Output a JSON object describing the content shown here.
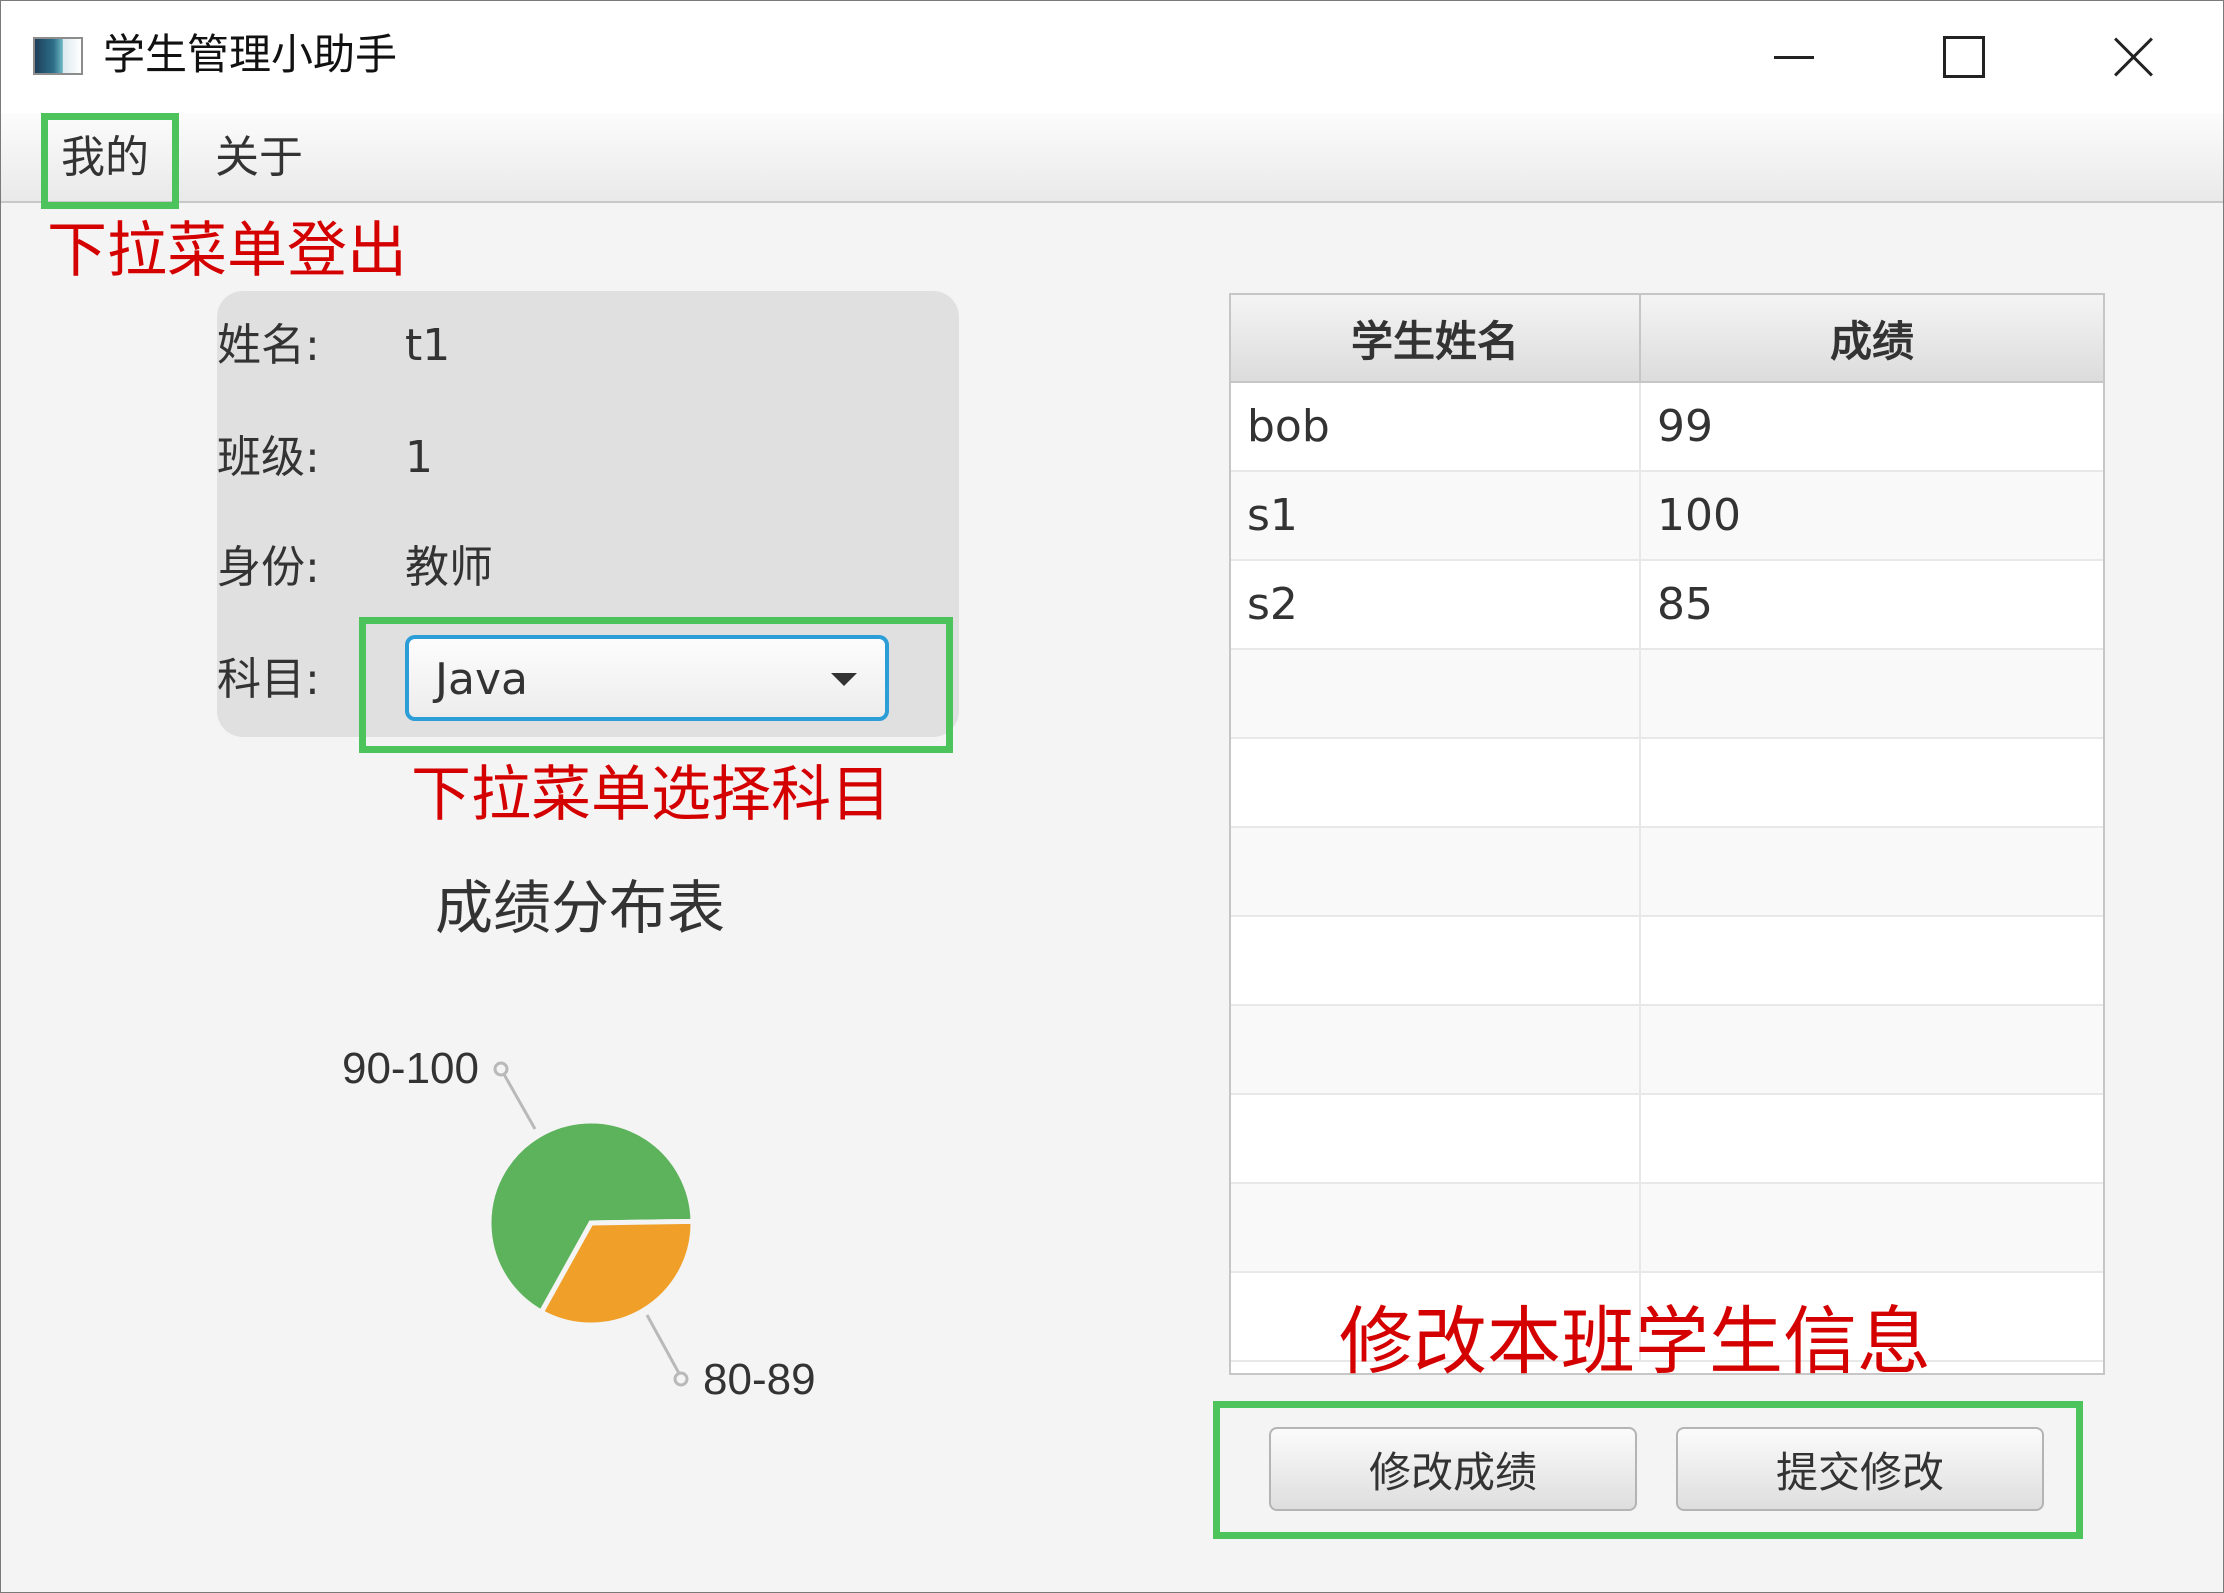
{
  "window": {
    "title": "学生管理小助手"
  },
  "menu": {
    "items": [
      "我的",
      "关于"
    ]
  },
  "annotations": {
    "logout": "下拉菜单登出",
    "select_subject": "下拉菜单选择科目",
    "edit_class": "修改本班学生信息"
  },
  "profile": {
    "name_label": "姓名:",
    "name_value": "t1",
    "class_label": "班级:",
    "class_value": "1",
    "role_label": "身份:",
    "role_value": "教师",
    "subject_label": "科目:",
    "subject_value": "Java"
  },
  "chart_data": {
    "type": "pie",
    "title": "成绩分布表",
    "labels": [
      "90-100",
      "80-89"
    ],
    "values": [
      2,
      1
    ],
    "colors": [
      "#5db35c",
      "#f0a028"
    ]
  },
  "table": {
    "columns": [
      "学生姓名",
      "成绩"
    ],
    "rows": [
      [
        "bob",
        "99"
      ],
      [
        "s1",
        "100"
      ],
      [
        "s2",
        "85"
      ]
    ]
  },
  "buttons": {
    "edit_score": "修改成绩",
    "submit": "提交修改"
  },
  "colors": {
    "annotation_red": "#d40000",
    "highlight_green": "#4cc35b",
    "focus_blue": "#2b9ed8"
  }
}
